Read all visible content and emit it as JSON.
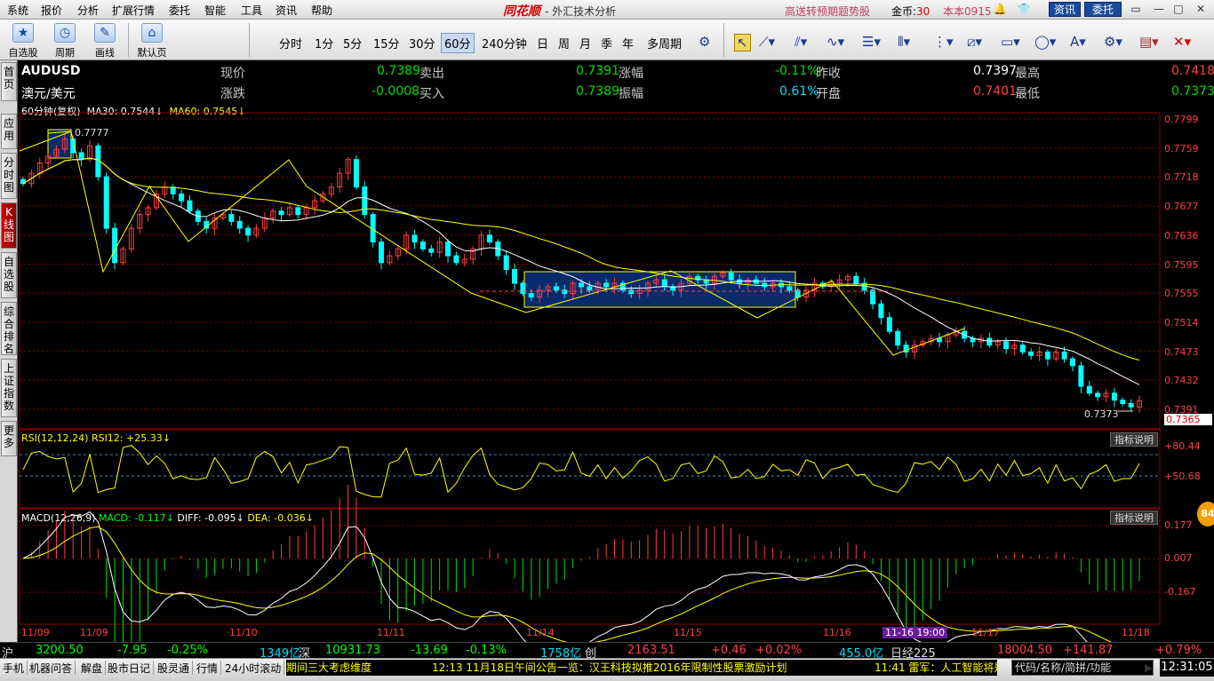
{
  "menu": [
    "系统",
    "报价",
    "分析",
    "扩展行情",
    "委托",
    "智能",
    "工具",
    "资讯",
    "帮助"
  ],
  "brand": {
    "name": "同花顺",
    "sub": "- 外汇技术分析"
  },
  "promo": "高送转预期题势股",
  "gold": {
    "label": "金币:",
    "value": "30"
  },
  "version": "本本0915",
  "top_buttons": {
    "news": "资讯",
    "order": "委托"
  },
  "toolbar": {
    "big_buttons": [
      "自选股",
      "周期",
      "画线",
      "默认页"
    ],
    "periods": [
      "分时",
      "1分",
      "5分",
      "15分",
      "30分",
      "60分",
      "240分钟",
      "日",
      "周",
      "月",
      "季",
      "年",
      "多周期"
    ],
    "active_period": "60分"
  },
  "sidebar_tabs": [
    "首页",
    "应用",
    "分时图",
    "K线图",
    "自选股",
    "综合排名",
    "上证指数",
    "更多"
  ],
  "quote": {
    "symbol": "AUDUSD",
    "name": "澳元/美元",
    "current_label": "现价",
    "current": "0.7389",
    "sell_label": "卖出",
    "sell": "0.7391",
    "pct_label": "涨幅",
    "pct": "-0.11%",
    "prev_close_label": "昨收",
    "prev_close": "0.7397",
    "high_label": "最高",
    "high": "0.7418",
    "change_label": "涨跌",
    "change": "-0.0008",
    "buy_label": "买入",
    "buy": "0.7389",
    "amp_label": "振幅",
    "amp": "0.61%",
    "open_label": "开盘",
    "open": "0.7401",
    "low_label": "最低",
    "low": "0.7373"
  },
  "main_indicator": {
    "period": "60分钟(复权)",
    "ma30": "MA30: 0.7544",
    "ma60": "MA60: 0.7545"
  },
  "rsi_indicator": {
    "label": "RSI(12,12,24)",
    "value": "RSI12: +25.33"
  },
  "macd_indicator": {
    "label": "MACD(12,26,9)",
    "macd": "MACD: -0.117",
    "diff": "DIFF: -0.095",
    "dea": "DEA: -0.036"
  },
  "explain_label": "指标说明",
  "annotations": {
    "high": "0.7777",
    "low": "0.7373"
  },
  "price_axis": [
    "0.7799",
    "0.7759",
    "0.7718",
    "0.7677",
    "0.7636",
    "0.7595",
    "0.7555",
    "0.7514",
    "0.7473",
    "0.7432",
    "0.7391"
  ],
  "price_badge": "0.7365",
  "rsi_axis": [
    "+80.44",
    "+50.68"
  ],
  "macd_axis": [
    "0.177",
    "0.007",
    "-0.167"
  ],
  "x_axis": [
    "11/09",
    "11/09",
    "11/10",
    "11/11",
    "11/14",
    "11/15",
    "11/16",
    "11/17",
    "11/18"
  ],
  "x_selected": "11-16 19:00",
  "index_bar": {
    "sh": {
      "label": "沪",
      "value": "3200.50",
      "change": "-7.95",
      "pct": "-0.25%",
      "vol": "1349亿"
    },
    "sz": {
      "label": "深",
      "value": "10931.73",
      "change": "-13.69",
      "pct": "-0.13%",
      "vol": "1758亿"
    },
    "cy": {
      "label": "创",
      "value": "2163.51",
      "change": "+0.46",
      "pct": "+0.02%",
      "vol": "455.0亿"
    },
    "n225": {
      "label": "日经225",
      "value": "18004.50",
      "change": "+141.87",
      "pct": "+0.79%"
    }
  },
  "status": {
    "buttons": [
      "手机",
      "机器问答",
      "解盘",
      "股市日记",
      "股灵通",
      "行情",
      "24小时滚动"
    ],
    "ticker_parts": [
      "期间三大考虑维度",
      "12:13 11月18日午间公告一览：汉王科技拟推2016年限制性股票激励计划",
      "11:41 雷军：人工智能将是"
    ],
    "search_placeholder": "代码/名称/简拼/功能",
    "clock": "12:31:05"
  },
  "badge": "84",
  "colors": {
    "up": "#ff3c3c",
    "down": "#00ffff",
    "ma30": "#ffffff",
    "ma60": "#ffff00",
    "grid": "#8a0000"
  },
  "chart_data": {
    "type": "candlestick",
    "symbol": "AUDUSD",
    "interval": "60min",
    "ylim": [
      0.7365,
      0.7799
    ],
    "high": 0.7777,
    "low": 0.7373,
    "note": "approximate hourly closes, left to right, 11/09 to 11/18",
    "closes": [
      0.7705,
      0.772,
      0.7735,
      0.7745,
      0.7755,
      0.777,
      0.775,
      0.774,
      0.776,
      0.7715,
      0.764,
      0.759,
      0.761,
      0.764,
      0.766,
      0.767,
      0.769,
      0.77,
      0.769,
      0.768,
      0.7665,
      0.765,
      0.764,
      0.7655,
      0.766,
      0.765,
      0.764,
      0.763,
      0.764,
      0.7655,
      0.7665,
      0.766,
      0.767,
      0.766,
      0.767,
      0.768,
      0.769,
      0.77,
      0.772,
      0.774,
      0.77,
      0.766,
      0.762,
      0.759,
      0.76,
      0.761,
      0.763,
      0.762,
      0.761,
      0.7605,
      0.762,
      0.76,
      0.759,
      0.7595,
      0.761,
      0.763,
      0.762,
      0.76,
      0.758,
      0.756,
      0.7545,
      0.754,
      0.755,
      0.7555,
      0.755,
      0.7545,
      0.756,
      0.7555,
      0.755,
      0.756,
      0.7555,
      0.756,
      0.755,
      0.7545,
      0.755,
      0.756,
      0.7565,
      0.7555,
      0.755,
      0.756,
      0.757,
      0.7565,
      0.756,
      0.757,
      0.7575,
      0.7565,
      0.756,
      0.7565,
      0.756,
      0.7555,
      0.756,
      0.7555,
      0.755,
      0.754,
      0.755,
      0.756,
      0.7555,
      0.756,
      0.7565,
      0.757,
      0.756,
      0.755,
      0.753,
      0.751,
      0.749,
      0.747,
      0.746,
      0.747,
      0.7475,
      0.748,
      0.7475,
      0.7485,
      0.749,
      0.748,
      0.7475,
      0.748,
      0.747,
      0.7475,
      0.7465,
      0.747,
      0.746,
      0.7455,
      0.746,
      0.745,
      0.746,
      0.745,
      0.744,
      0.741,
      0.74,
      0.7395,
      0.74,
      0.739,
      0.7385,
      0.738,
      0.7389
    ]
  }
}
